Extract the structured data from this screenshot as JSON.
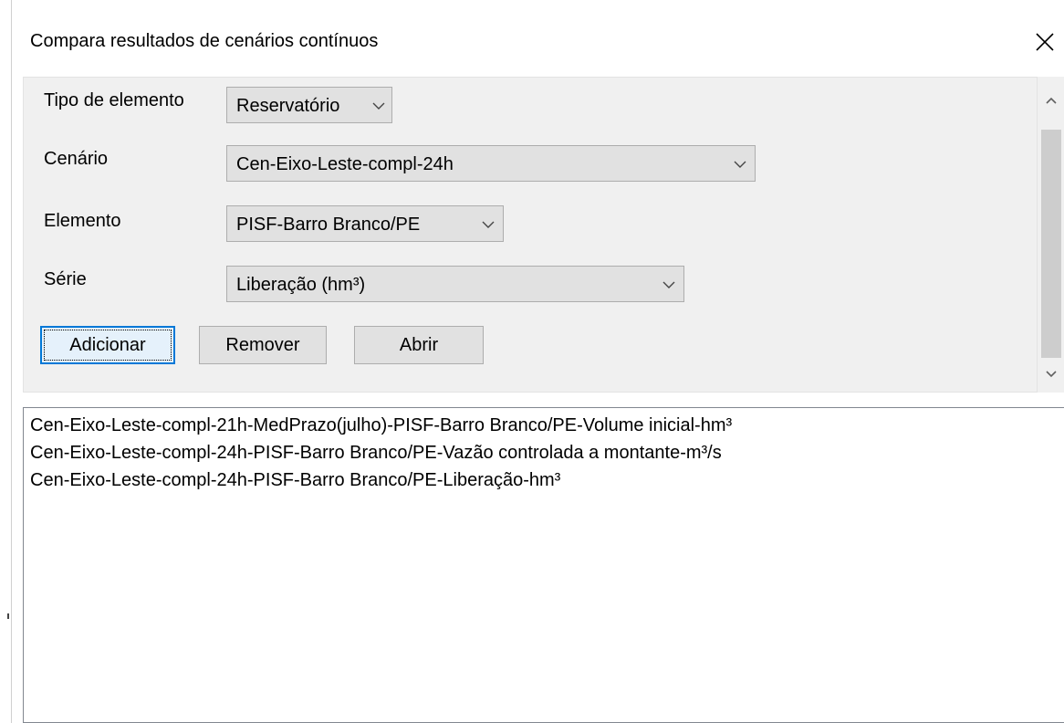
{
  "window": {
    "title": "Compara resultados de cenários contínuos"
  },
  "form": {
    "tipo_elemento": {
      "label": "Tipo de elemento",
      "value": "Reservatório"
    },
    "cenario": {
      "label": "Cenário",
      "value": "Cen-Eixo-Leste-compl-24h"
    },
    "elemento": {
      "label": "Elemento",
      "value": "PISF-Barro Branco/PE"
    },
    "serie": {
      "label": "Série",
      "value": "Liberação (hm³)"
    }
  },
  "buttons": {
    "adicionar": "Adicionar",
    "remover": "Remover",
    "abrir": "Abrir"
  },
  "results": [
    "Cen-Eixo-Leste-compl-21h-MedPrazo(julho)-PISF-Barro Branco/PE-Volume inicial-hm³",
    "Cen-Eixo-Leste-compl-24h-PISF-Barro Branco/PE-Vazão controlada a montante-m³/s",
    "Cen-Eixo-Leste-compl-24h-PISF-Barro Branco/PE-Liberação-hm³"
  ],
  "colors": {
    "accent": "#0078d7",
    "panel_bg": "#f0f0f0",
    "control_bg": "#e1e1e1"
  }
}
